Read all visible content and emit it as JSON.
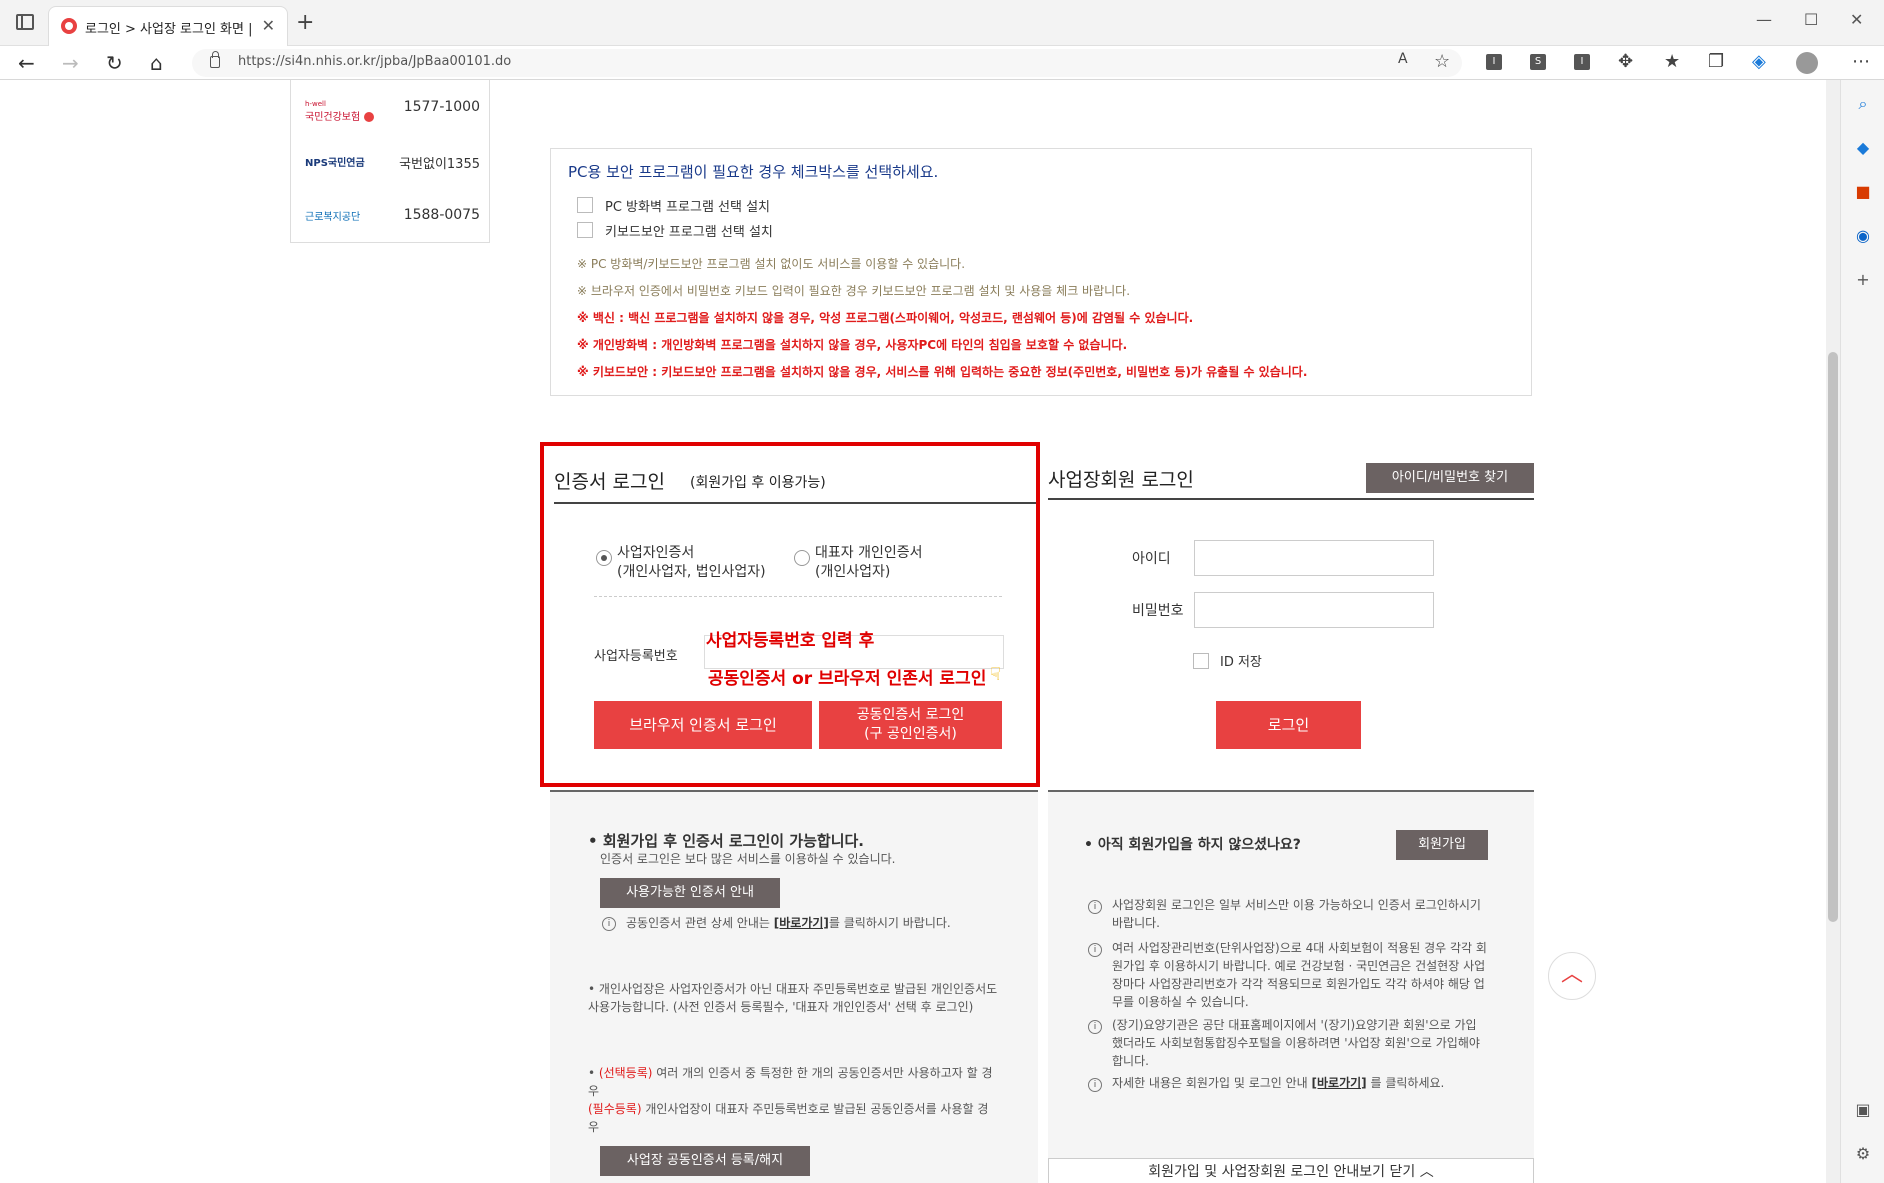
{
  "browser": {
    "tab_title": "로그인 > 사업장 로그인 화면 | h",
    "url": "https://si4n.nhis.or.kr/jpba/JpBaa00101.do"
  },
  "contacts": [
    {
      "name": "국민건강보험",
      "tag": "h-well",
      "number": "1577-1000"
    },
    {
      "name": "NPS국민연금",
      "tag": "",
      "number": "국번없이1355"
    },
    {
      "name": "근로복지공단",
      "tag": "",
      "number": "1588-0075"
    }
  ],
  "security": {
    "title": "PC용 보안 프로그램이 필요한 경우 체크박스를 선택하세요.",
    "options": [
      "PC 방화벽 프로그램 선택 설치",
      "키보드보안 프로그램 선택 설치"
    ],
    "notes": [
      "※ PC 방화벽/키보드보안 프로그램 설치 없이도 서비스를 이용할 수 있습니다.",
      "※ 브라우저 인증에서 비밀번호 키보드 입력이 필요한 경우 키보드보안 프로그램 설치 및 사용을 체크 바랍니다.",
      "※ 백신 : 백신 프로그램을 설치하지 않을 경우, 악성 프로그램(스파이웨어, 악성코드, 랜섬웨어 등)에 감염될 수 있습니다.",
      "※ 개인방화벽 : 개인방화벽 프로그램을 설치하지 않을 경우, 사용자PC에 타인의 침입을 보호할 수 없습니다.",
      "※ 키보드보안 : 키보드보안 프로그램을 설치하지 않을 경우, 서비스를 위해 입력하는 중요한 정보(주민번호, 비밀번호 등)가 유출될 수 있습니다."
    ]
  },
  "cert_login": {
    "title": "인증서 로그인",
    "subtitle": "(회원가입 후 이용가능)",
    "radio1_line1": "사업자인증서",
    "radio1_line2": "(개인사업자, 법인사업자)",
    "radio2_line1": "대표자 개인인증서",
    "radio2_line2": "(개인사업자)",
    "bizno_label": "사업자등록번호",
    "annotation1": "사업자등록번호 입력 후",
    "annotation2": "공동인증서 or 브라우저 인존서 로그인",
    "browser_btn": "브라우저 인증서 로그인",
    "joint_btn_line1": "공동인증서 로그인",
    "joint_btn_line2": "(구 공인인증서)"
  },
  "biz_login": {
    "title": "사업장회원 로그인",
    "find_btn": "아이디/비밀번호 찾기",
    "id_label": "아이디",
    "pw_label": "비밀번호",
    "id_save": "ID 저장",
    "login_btn": "로그인"
  },
  "cert_info": {
    "title": "회원가입 후 인증서 로그인이 가능합니다.",
    "subtitle": "인증서 로그인은 보다 많은 서비스를 이용하실 수 있습니다.",
    "available_btn": "사용가능한 인증서 안내",
    "detail_pre": "공동인증서 관련 상세 안내는 ",
    "detail_link": "[바로가기]",
    "detail_post": "를 클릭하시기 바랍니다.",
    "personal_note": "개인사업장은 사업자인증서가 아닌 대표자 주민등록번호로 발급된 개인인증서도 사용가능합니다. (사전 인증서 등록필수, '대표자 개인인증서' 선택 후 로그인)",
    "select_tag": "(선택등록)",
    "select_text": " 여러 개의 인증서 중 특정한 한 개의 공동인증서만 사용하고자 할 경우",
    "required_tag": "(필수등록)",
    "required_text": " 개인사업장이 대표자 주민등록번호로 발급된 공동인증서를 사용할 경우",
    "register_btn": "사업장 공동인증서 등록/해지"
  },
  "member_info": {
    "title": "아직 회원가입을 하지 않으셨나요?",
    "join_btn": "회원가입",
    "notes": [
      "사업장회원 로그인은 일부 서비스만 이용 가능하오니 인증서 로그인하시기 바랍니다.",
      "여러 사업장관리번호(단위사업장)으로 4대 사회보험이 적용된 경우 각각 회원가입 후 이용하시기 바랍니다. 예로 건강보험 · 국민연금은 건설현장 사업장마다 사업장관리번호가 각각 적용되므로 회원가입도 각각 하셔야 해당 업무를 이용하실 수 있습니다.",
      "(장기)요양기관은 공단 대표홈페이지에서 '(장기)요양기관 회원'으로 가입했더라도 사회보험통합징수포털을 이용하려면 '사업장 회원'으로 가입해야 합니다."
    ],
    "guide_pre": "자세한 내용은 회원가입 및 로그인 안내 ",
    "guide_link": "[바로가기]",
    "guide_post": " 를 클릭하세요.",
    "toggle": "회원가입 및 사업장회원 로그인 안내보기 닫기 ︿"
  },
  "icons": [
    "tab-grid-icon",
    "back-icon",
    "forward-icon",
    "refresh-icon",
    "home-icon",
    "lock-icon",
    "read-aloud-icon",
    "favorite-add-icon",
    "extensions-icon",
    "favorites-icon",
    "collections-icon",
    "profile-icon",
    "more-icon",
    "search-icon",
    "shopping-icon",
    "office-icon",
    "outlook-icon",
    "add-icon",
    "up-arrow-icon",
    "pointing-hand-icon"
  ]
}
